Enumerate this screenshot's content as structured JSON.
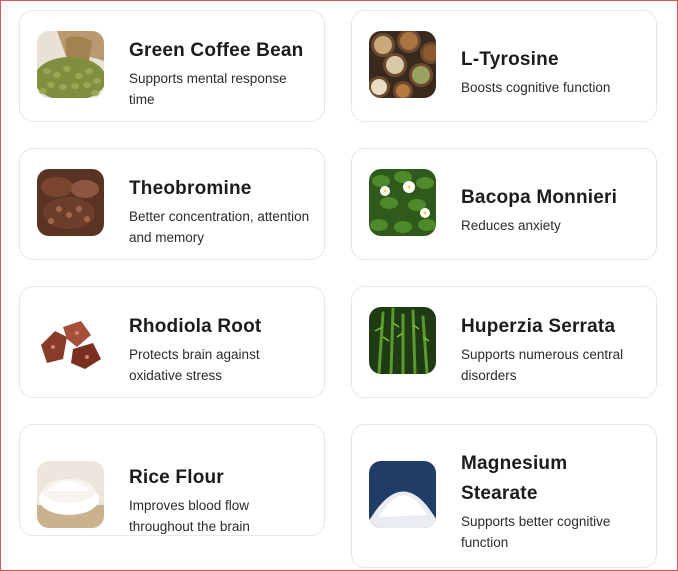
{
  "ingredients": [
    {
      "name": "Green Coffee Bean",
      "description": "Supports mental response time",
      "image": "green-coffee-beans-photo"
    },
    {
      "name": "L-Tyrosine",
      "description": "Boosts cognitive function",
      "image": "nuts-and-seeds-bowls-photo"
    },
    {
      "name": "Theobromine",
      "description": "Better concentration, attention and memory",
      "image": "cocoa-beans-photo"
    },
    {
      "name": "Bacopa Monnieri",
      "description": "Reduces anxiety",
      "image": "white-flower-leaves-photo"
    },
    {
      "name": "Rhodiola Root",
      "description": "Protects brain against oxidative stress",
      "image": "dried-root-pieces-photo"
    },
    {
      "name": "Huperzia Serrata",
      "description": "Supports numerous central disorders",
      "image": "fern-plant-photo"
    },
    {
      "name": "Rice Flour",
      "description": "Improves blood flow throughout the brain",
      "image": "rice-flour-bowl-photo"
    },
    {
      "name": "Magnesium Stearate",
      "description": "Supports better cognitive function",
      "image": "white-powder-pile-photo"
    }
  ]
}
